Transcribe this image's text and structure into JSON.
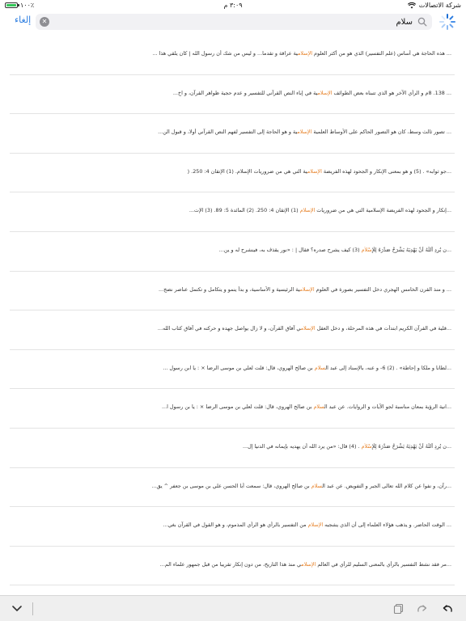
{
  "status_bar": {
    "carrier": "شركة الاتصالات",
    "time": "٣:٠٩ م",
    "battery": "١٠٠٪"
  },
  "search": {
    "query": "سلام",
    "cancel_label": "إلغاء"
  },
  "results": [
    {
      "before": "... هذه الحاجة هي أساس (علم التفسير) الذي هو من أكثر العلوم ",
      "match": "الإسلام",
      "after": "ية عراقة و تقدما... و ليس من شك أن رسول الله | كان يلقي هذا ..."
    },
    {
      "before": "... 138. 8م و الرأي الآخر هو الذي تتبناه بعض الطوائف ",
      "match": "الإسلام",
      "after": "ية في إباء النص القرآني للتفسير و عدم حجية ظواهر القرآن، و اخ..."
    },
    {
      "before": "... تصور ثالث وسط، كان هو التصور الحاكم على الأوساط العلمية ",
      "match": "الإسلام",
      "after": "ية و هو الحاجة إلى التفسير لفهم النص القرآني أولا، و قبول الن..."
    },
    {
      "before": "...جو ثوابه» . (5) و هو بمعنى الإنكار و الجحود لهذه الفريضة ",
      "match": "الإسلام",
      "after": "ية التي هي من ضروريات الإسلام. (1) الإتقان 4: 250. ("
    },
    {
      "before": "...إنكار و الجحود لهذه الفريضة الإسلامية التي هي من ضروريات ",
      "match": "الإسلام",
      "after": " (1) الإتقان 4: 250. (2) المائدة 5: 89. (3) الإت..."
    },
    {
      "before": "...ن يُرِدِ اَللّٰهُ أَنْ يَهْدِيَهُ يَشْرَحْ صَدْرَهُ لِلْ",
      "match": "إِسْلاٰمِ",
      "after": " (3) كيف يشرح صدره؟ فقال | : «نور يقذف به، فينشرح له و ين..."
    },
    {
      "before": "... و منذ القرن الخامس الهجري دخل التفسير بصورة في العلوم ",
      "match": "الإسلام",
      "after": "ية الرئيسية و الأساسية، و بدأ ينمو و يتكامل و تكتمل عناصر نضج..."
    },
    {
      "before": "...قلية في القرآن الكريم ابتدأت في هذه المرحلة، و دخل العقل ",
      "match": "الإسلام",
      "after": "ي آفاق القرآن، و لا زال يواصل جهده و حركته في آفاق كتاب الله..."
    },
    {
      "before": "...لطانا و ملكا و إحاطة» . (2) 6- و عنه، بالإسناد إلى عبد ال",
      "match": "سلام",
      "after": " بن صالح الهروي، قال: قلت لعلي بن موسى الرضا × : يا ابن رسول ..."
    },
    {
      "before": "...انية الرؤية بمعان مناسبة لجو الآيات و الروايات. عن عبد ال",
      "match": "سلام",
      "after": " بن صالح الهروي، قال: قلت لعلي بن موسى الرضا × : يا بن رسول ا..."
    },
    {
      "before": "...ن يُرِدِ اَللّٰهُ أَنْ يَهْدِيَهُ يَشْرَحْ صَدْرَهُ لِلْ",
      "match": "إِسْلاٰمِ",
      "after": " . (4) قال: «من يرد الله أن يهديه بإيمانه في الدنيا إل..."
    },
    {
      "before": "...رآن، و نفوا عن كلام الله تعالى الجبر و التفويض. عن عبد ال",
      "match": "سلام",
      "after": " بن صالح الهروي، قال: سمعت أبا الحسن علي بن موسى بن جعفر ^ يق..."
    },
    {
      "before": "... الوقت الحاضر. و يذهب هؤلاء العلماء إلى أن الذي يشجبه ",
      "match": "الإسلام",
      "after": " من التفسير بالرأي هو الرأي المذموم، و هو القول في القرآن بغي..."
    },
    {
      "before": "...مر فقد نشط التفسير بالرأي بالمعنى السليم للرأي في العالم ",
      "match": "الإسلام",
      "after": "ي منذ هذا التاريخ، من دون إنكار تقريبا من قبل جمهور علماء الم..."
    }
  ],
  "colors": {
    "highlight": "#e67e22",
    "accent": "#2a7ce0"
  },
  "icons": {
    "toolbar": [
      "chevron-down-icon",
      "copy-icon",
      "redo-icon",
      "undo-icon"
    ]
  }
}
